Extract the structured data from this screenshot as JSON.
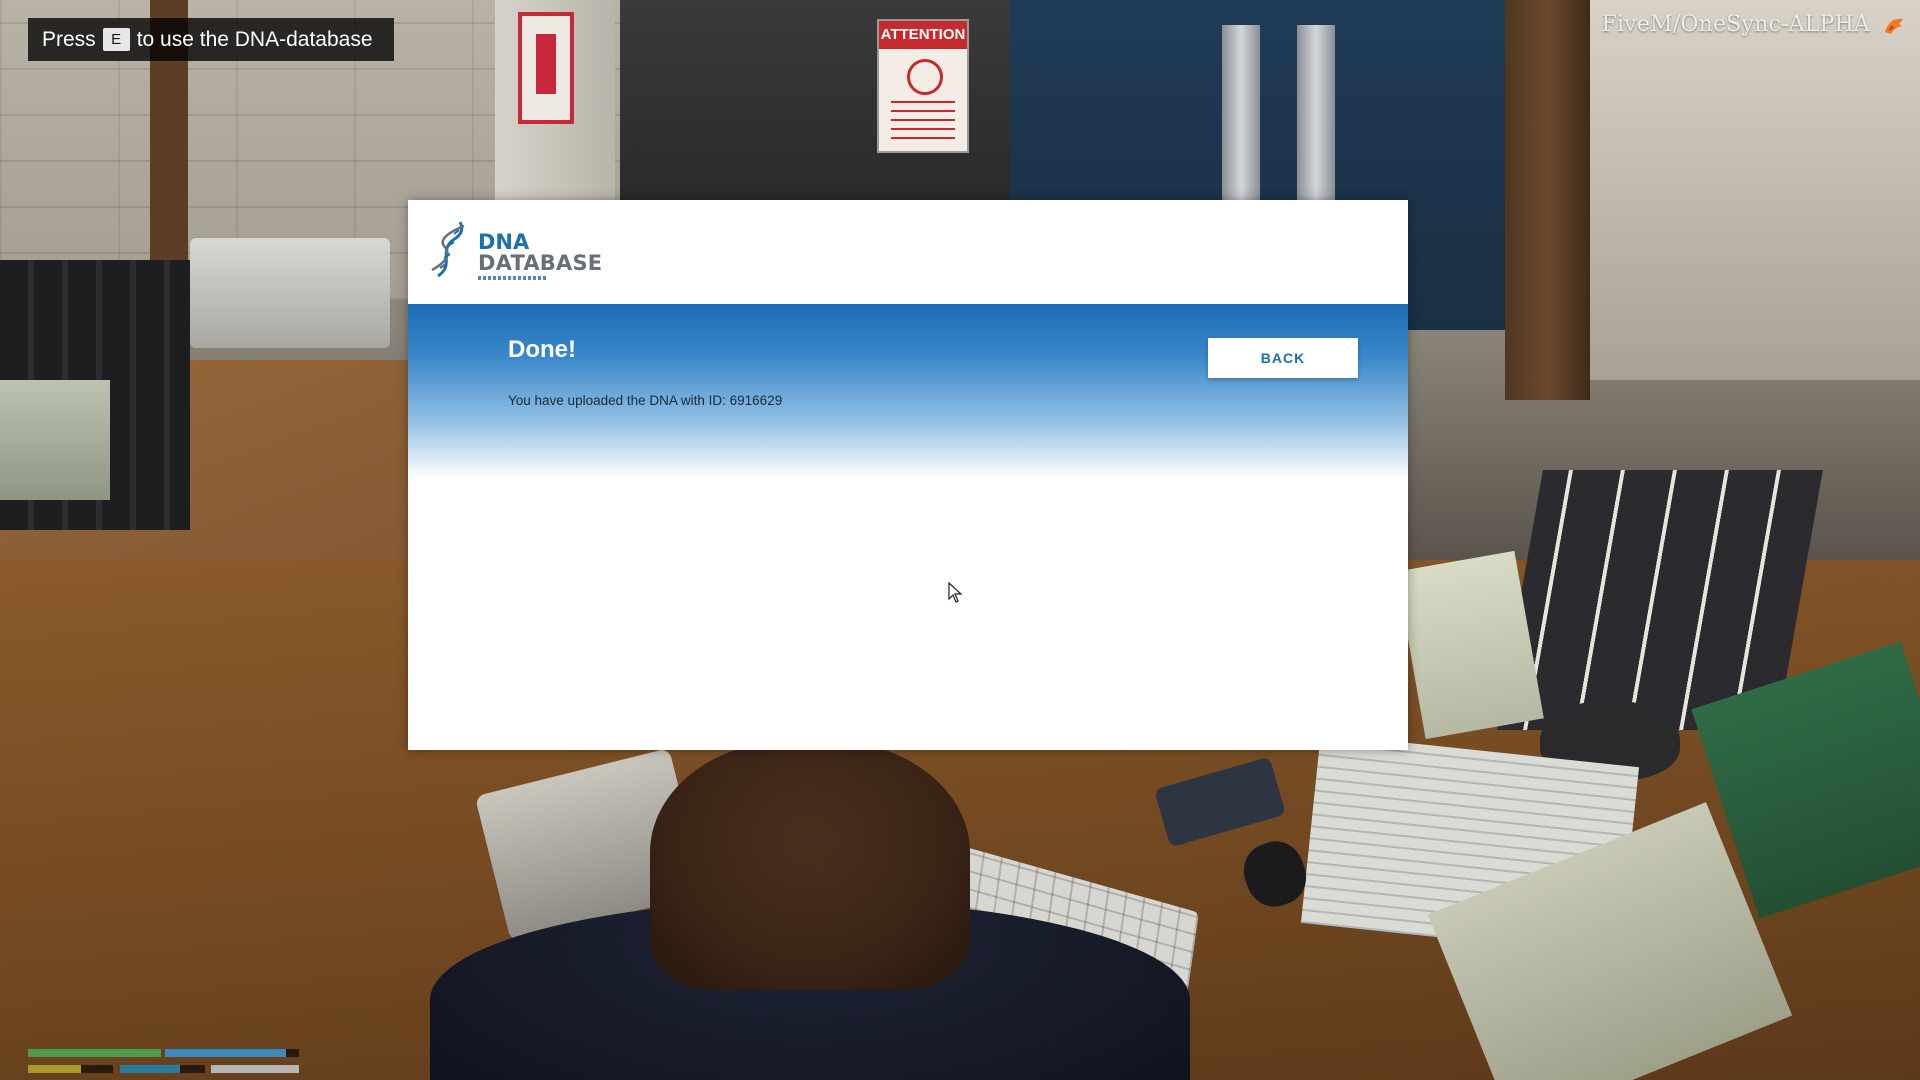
{
  "hud": {
    "help_prefix": "Press",
    "help_key": "E",
    "help_suffix": "to use the DNA-database",
    "server_name": "FiveM/OneSync-ALPHA",
    "server_icon": "fivem-logo-icon"
  },
  "status_bars": {
    "health": {
      "fraction": 1.0,
      "color": "#4e9a4c"
    },
    "armor": {
      "fraction": 0.9,
      "color": "#3b8ac0"
    },
    "stat_yellow": {
      "fraction": 0.62,
      "color": "#a89a2a"
    },
    "stat_teal": {
      "fraction": 0.7,
      "color": "#2a7d9c"
    },
    "stat_grey": {
      "fraction": 1.0,
      "color": "#b5b5b5"
    }
  },
  "dna_app": {
    "logo_title": "DNA",
    "logo_subtitle": "DATABASE",
    "logo_icon": "dna-helix-icon",
    "accent_color": "#1d6fb0",
    "result_title": "Done!",
    "result_message": "You have uploaded the DNA with ID: 6916629",
    "back_label": "BACK"
  },
  "environment": {
    "sign_attention": "ATTENTION"
  }
}
